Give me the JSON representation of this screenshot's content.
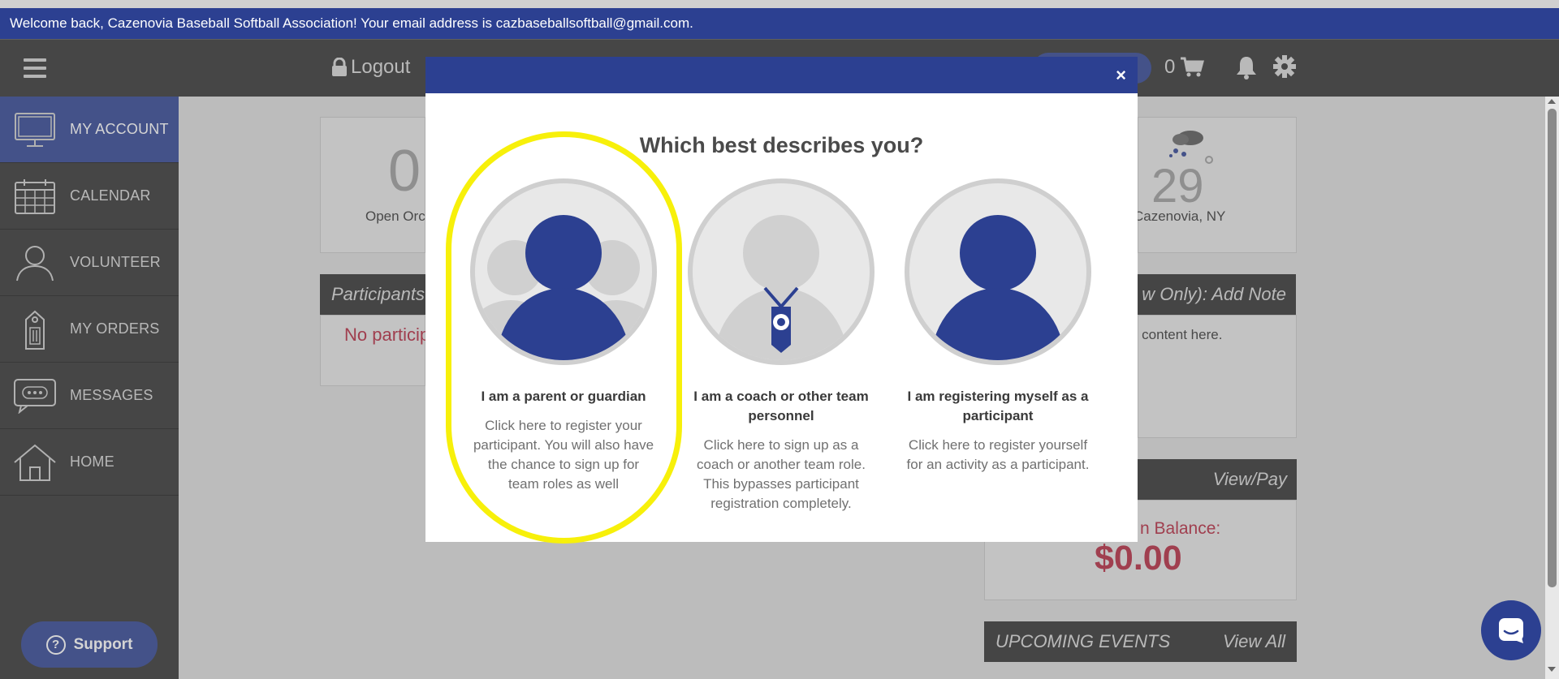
{
  "welcome": {
    "text": "Welcome back, Cazenovia Baseball Softball Association! Your email address is cazbaseballsoftball@gmail.com."
  },
  "header": {
    "logout_label": "Logout",
    "cart_count": "0",
    "icons": [
      "hamburger-icon",
      "lock-icon",
      "cart-icon",
      "bell-icon",
      "gear-icon"
    ]
  },
  "sidebar": {
    "items": [
      {
        "label": "MY ACCOUNT",
        "icon": "monitor-icon",
        "active": true
      },
      {
        "label": "CALENDAR",
        "icon": "calendar-icon",
        "active": false
      },
      {
        "label": "VOLUNTEER",
        "icon": "person-outline-icon",
        "active": false
      },
      {
        "label": "MY ORDERS",
        "icon": "tag-icon",
        "active": false
      },
      {
        "label": "MESSAGES",
        "icon": "chat-bubble-icon",
        "active": false
      },
      {
        "label": "HOME",
        "icon": "house-icon",
        "active": false
      }
    ],
    "support_label": "Support"
  },
  "background": {
    "open_orders_count": "0",
    "open_orders_label": "Open Orc",
    "participants_head": "Participants",
    "no_participants": "No particip",
    "weather_temp": "29",
    "weather_location": "Cazenovia, NY",
    "notes_head": "w Only):  Add Note",
    "notes_text": "d content here.",
    "pay_head": "View/Pay",
    "balance_label": "n Balance:",
    "balance_amount": "$0.00",
    "events_head": "UPCOMING EVENTS",
    "events_view_all": "View All"
  },
  "modal": {
    "title": "Which best describes you?",
    "close_label": "×",
    "options": [
      {
        "title": "I am a parent or guardian",
        "desc": "Click here to register your participant. You will also have the chance to sign up for team roles as well",
        "icon": "family-icon"
      },
      {
        "title": "I am a coach or other team personnel",
        "desc": "Click here to sign up as a coach or another team role. This bypasses participant registration completely.",
        "icon": "coach-whistle-icon"
      },
      {
        "title": "I am registering myself as a participant",
        "desc": "Click here to register yourself for an activity as a participant.",
        "icon": "person-icon"
      }
    ]
  },
  "colors": {
    "brand_blue": "#2c4091",
    "highlight": "#f7f00a",
    "alert_red": "#b3243b",
    "dark": "#2f2f2f"
  }
}
